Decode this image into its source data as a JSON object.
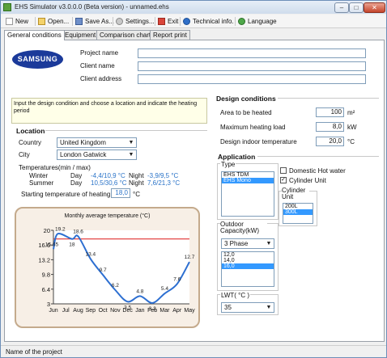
{
  "window": {
    "title": "EHS Simulator v3.0.0.0 (Beta version) - unnamed.ehs",
    "min": "–",
    "max": "□",
    "close": "✕"
  },
  "toolbar": {
    "new": "New",
    "open": "Open...",
    "save_as": "Save As...",
    "settings": "Settings...",
    "exit": "Exit",
    "tech_info": "Technical info.",
    "language": "Language"
  },
  "tabs": [
    "General conditions",
    "Equipment",
    "Comparison chart",
    "Report print"
  ],
  "logo": "SAMSUNG",
  "project": {
    "name_label": "Project name",
    "client_label": "Client name",
    "address_label": "Client address"
  },
  "info_text": "Input the design condition and choose a location and indicate the heating period",
  "location": {
    "title": "Location",
    "country_label": "Country",
    "country": "United Kingdom",
    "city_label": "City",
    "city": "London Gatwick",
    "temps_label": "Temperatures(min / max)",
    "winter_label": "Winter",
    "summer_label": "Summer",
    "day_label": "Day",
    "night_label": "Night",
    "winter_day": "-4,4/10,9 °C",
    "winter_night": "-3,9/9,5 °C",
    "summer_day": "10,5/30,6 °C",
    "summer_night": "7,6/21,3 °C",
    "start_label": "Starting temperature of heating",
    "start_value": "18,0",
    "start_unit": "°C"
  },
  "design": {
    "title": "Design conditions",
    "area_label": "Area to be heated",
    "area_value": "100",
    "area_unit": "m²",
    "load_label": "Maximum heating load",
    "load_value": "8,0",
    "load_unit": "kW",
    "indoor_label": "Design indoor temperature",
    "indoor_value": "20,0",
    "indoor_unit": "°C"
  },
  "application": {
    "title": "Application",
    "type_label": "Type",
    "types": [
      "EHS TDM",
      "EHS Mono"
    ],
    "type_selected": 1,
    "domestic_label": "Domestic Hot water",
    "domestic_checked": false,
    "cylinder_label": "Cylinder Unit",
    "cylinder_checked": true,
    "cylinder_unit_label": "Cylinder Unit",
    "cylinder_units": [
      "200L",
      "300L"
    ],
    "cylinder_selected": 1,
    "outdoor_label": "Outdoor Capacity(kW)",
    "phase": "3 Phase",
    "capacities": [
      "12,0",
      "14,0",
      "16,0"
    ],
    "capacity_selected": 2,
    "lwt_label": "LWT( °C )",
    "lwt_value": "35"
  },
  "status": {
    "text": "Name of the project"
  },
  "colors": {
    "accent": "#2a73c8",
    "chart_frame": "#c4aa8c",
    "line": "#2d6fd1",
    "start_line": "#e03030",
    "selection": "#3399ff"
  },
  "chart_data": {
    "type": "line",
    "title": "Monthly average temperature (°C)",
    "categories": [
      "Jun",
      "Jul",
      "Aug",
      "Sep",
      "Oct",
      "Nov",
      "Dec",
      "Jan",
      "Feb",
      "Mar",
      "Apr",
      "May"
    ],
    "values": [
      15.65,
      19.2,
      18,
      18.6,
      13.4,
      9.7,
      6.2,
      3.5,
      4.8,
      3.2,
      5.4,
      7.6,
      12.7
    ],
    "value_labels": [
      "15.65",
      "19.2",
      "18",
      "18.6",
      "13.4",
      "9.7",
      "6.2",
      "3.5",
      "4.8",
      "3.2",
      "5.4",
      "7.6",
      "12.7"
    ],
    "value_x": [
      0,
      0.35,
      1.5,
      2,
      3,
      4,
      5,
      6,
      7,
      8,
      9,
      10,
      11
    ],
    "y_ticks": [
      "20",
      "16.6",
      "13.2",
      "9.8",
      "6.4",
      "3"
    ],
    "ylim": [
      3,
      20
    ],
    "reference_line": 18.0
  }
}
